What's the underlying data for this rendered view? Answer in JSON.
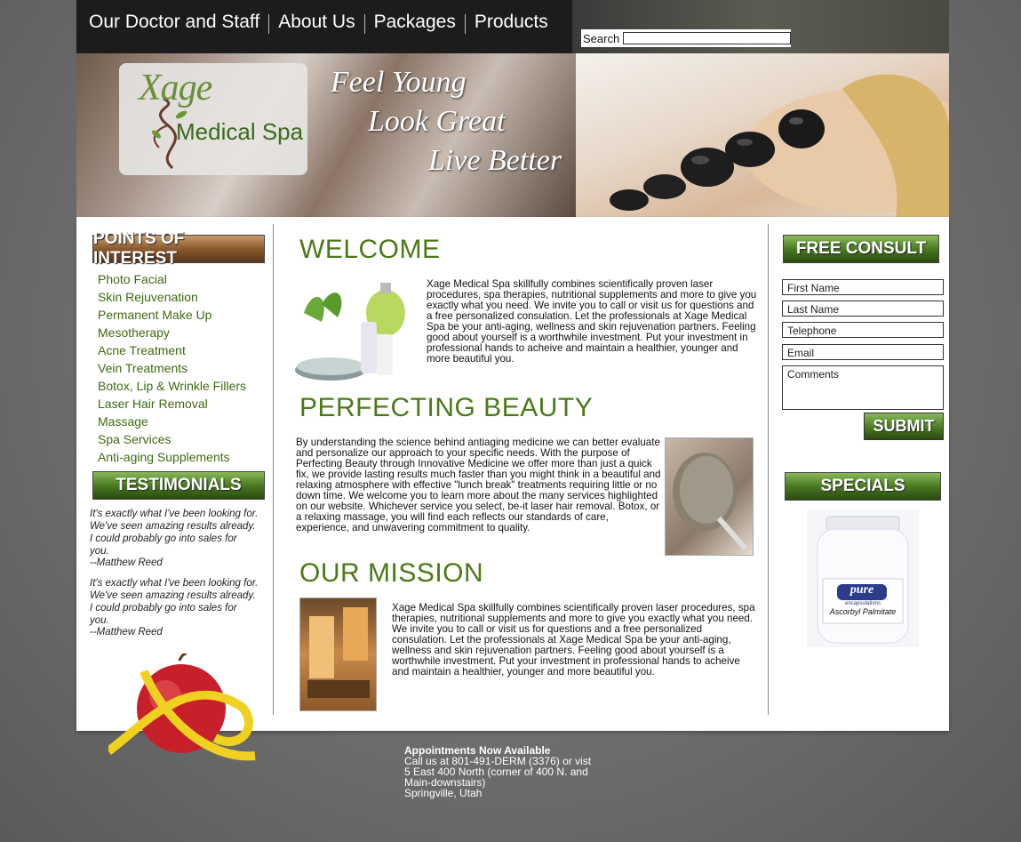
{
  "nav": {
    "items": [
      {
        "label": "Our Doctor and Staff"
      },
      {
        "label": "About Us"
      },
      {
        "label": "Packages"
      },
      {
        "label": "Products"
      }
    ],
    "search_label": "Search",
    "search_value": ""
  },
  "banner": {
    "logo_word1": "Xage",
    "logo_word2": "Medical Spa",
    "tagline": [
      "Feel Young",
      "Look Great",
      "Live Better"
    ]
  },
  "sidebar": {
    "poi_heading": "POINTS OF INTEREST",
    "items": [
      "Photo Facial",
      "Skin Rejuvenation",
      "Permanent Make Up",
      "Mesotherapy",
      "Acne Treatment",
      "Vein Treatments",
      "Botox, Lip & Wrinkle Fillers",
      "Laser Hair Removal",
      "Massage",
      "Spa Services",
      "Anti-aging Supplements"
    ],
    "testimonials_heading": "TESTIMONIALS",
    "testimonials": [
      {
        "quote": "It's exactly what I've been looking for. We've seen amazing results already. I could probably go into sales for you.",
        "author": "--Matthew Reed"
      },
      {
        "quote": "It's exactly what I've been looking for. We've seen amazing results already. I could probably go into sales for you.",
        "author": "--Matthew Reed"
      }
    ]
  },
  "main": {
    "welcome_title": "WELCOME",
    "welcome_text": "Xage Medical Spa skillfully combines scientifically proven laser procedures, spa therapies, nutritional supplements and more to give you exactly what you need.  We invite you to call or visit us for questions and a free personalized consulation. Let the professionals at Xage Medical Spa be your anti-aging, wellness and skin rejuvenation partners. Feeling good about yourself is a worthwhile investment. Put your investment in professional hands to acheive and maintain a healthier, younger and more beautiful you.",
    "beauty_title": "PERFECTING BEAUTY",
    "beauty_text": "By understanding the science behind antiaging medicine we can better evaluate and personalize our approach to your specific needs. With the purpose of Perfecting Beauty through Innovative Medicine we offer more than just a quick fix, we provide lasting results much faster than you might think in a beautiful and relaxing atmosphere with effective \"lunch break\" treatments requiring little or no down time. We welcome you to learn more about the many services highlighted on our website. Whichever service you select, be-it laser hair removal. Botox, or a relaxing massage, you will find each reflects our standards of care, experience, and unwavering commitment to quality.",
    "mission_title": "OUR MISSION",
    "mission_text": "Xage Medical Spa skillfully combines scientifically proven laser procedures, spa therapies, nutritional supplements and more to give you exactly what you need.  We invite you to call or visit us for questions and a free personalized consulation. Let the professionals at Xage Medical Spa be your anti-aging, wellness and skin rejuvenation partners. Feeling good about yourself is a worthwhile investment. Put your investment in professional hands to acheive and maintain a healthier, younger and more beautiful you."
  },
  "consult": {
    "heading": "FREE CONSULT",
    "first_name": "First Name",
    "last_name": "Last Name",
    "telephone": "Telephone",
    "email": "Email",
    "comments": "Comments",
    "submit": "SUBMIT",
    "specials_heading": "SPECIALS",
    "product_brand": "pure",
    "product_sub": "encapsulations",
    "product_name": "Ascorbyl Palmitate"
  },
  "footer": {
    "line1": "Appointments Now Available",
    "line2": "Call us at 801-491-DERM (3376) or vist",
    "line3": "5 East 400 North (corner of 400 N. and",
    "line4": "Main-downstairs)",
    "line5": "Springville, Utah"
  },
  "colors": {
    "accent_green": "#4a7a18",
    "link_green": "#3d6a12",
    "topbar": "#1c1c1c"
  }
}
